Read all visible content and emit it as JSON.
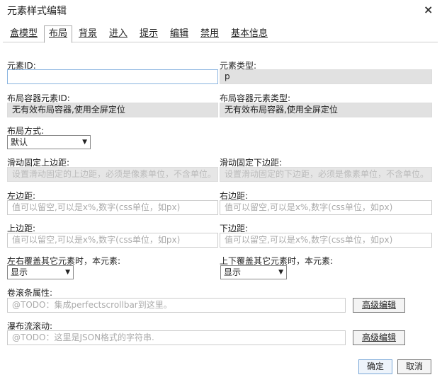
{
  "window": {
    "title": "元素样式编辑",
    "close_label": "×"
  },
  "tabs": [
    {
      "label": "盒模型"
    },
    {
      "label": "布局"
    },
    {
      "label": "背景"
    },
    {
      "label": "进入"
    },
    {
      "label": "提示"
    },
    {
      "label": "编辑"
    },
    {
      "label": "禁用"
    },
    {
      "label": "基本信息"
    }
  ],
  "form": {
    "element_id": {
      "label": "元素ID:",
      "value": ""
    },
    "element_type": {
      "label": "元素类型:",
      "value": "p"
    },
    "container_id": {
      "label": "布局容器元素ID:",
      "value": "无有效布局容器,使用全屏定位"
    },
    "container_type": {
      "label": "布局容器元素类型:",
      "value": "无有效布局容器,使用全屏定位"
    },
    "layout_mode": {
      "label": "布局方式:",
      "value": "默认"
    },
    "scroll_top": {
      "label": "滑动固定上边距:",
      "placeholder": "设置滑动固定的上边距，必须是像素单位，不含单位。"
    },
    "scroll_bottom": {
      "label": "滑动固定下边距:",
      "placeholder": "设置滑动固定的下边距，必须是像素单位，不含单位。"
    },
    "left": {
      "label": "左边距:",
      "placeholder": "值可以留空,可以是x%,数字(css单位，如px)"
    },
    "right": {
      "label": "右边距:",
      "placeholder": "值可以留空,可以是x%,数字(css单位，如px)"
    },
    "top": {
      "label": "上边距:",
      "placeholder": "值可以留空,可以是x%,数字(css单位，如px)"
    },
    "bottom": {
      "label": "下边距:",
      "placeholder": "值可以留空,可以是x%,数字(css单位，如px)"
    },
    "h_overlap": {
      "label": "左右覆盖其它元素时，本元素:",
      "value": "显示"
    },
    "v_overlap": {
      "label": "上下覆盖其它元素时，本元素:",
      "value": "显示"
    },
    "scrollbar": {
      "label": "卷滚条属性:",
      "placeholder": "@TODO：集成perfectscrollbar到这里。",
      "button": "高级编辑"
    },
    "waterfall": {
      "label": "瀑布流滚动:",
      "placeholder": "@TODO：这里是JSON格式的字符串.",
      "button": "高级编辑"
    }
  },
  "footer": {
    "ok_label": "确定",
    "cancel_label": "取消"
  },
  "icons": {
    "close": "close-icon",
    "dropdown": "chevron-down-icon"
  }
}
